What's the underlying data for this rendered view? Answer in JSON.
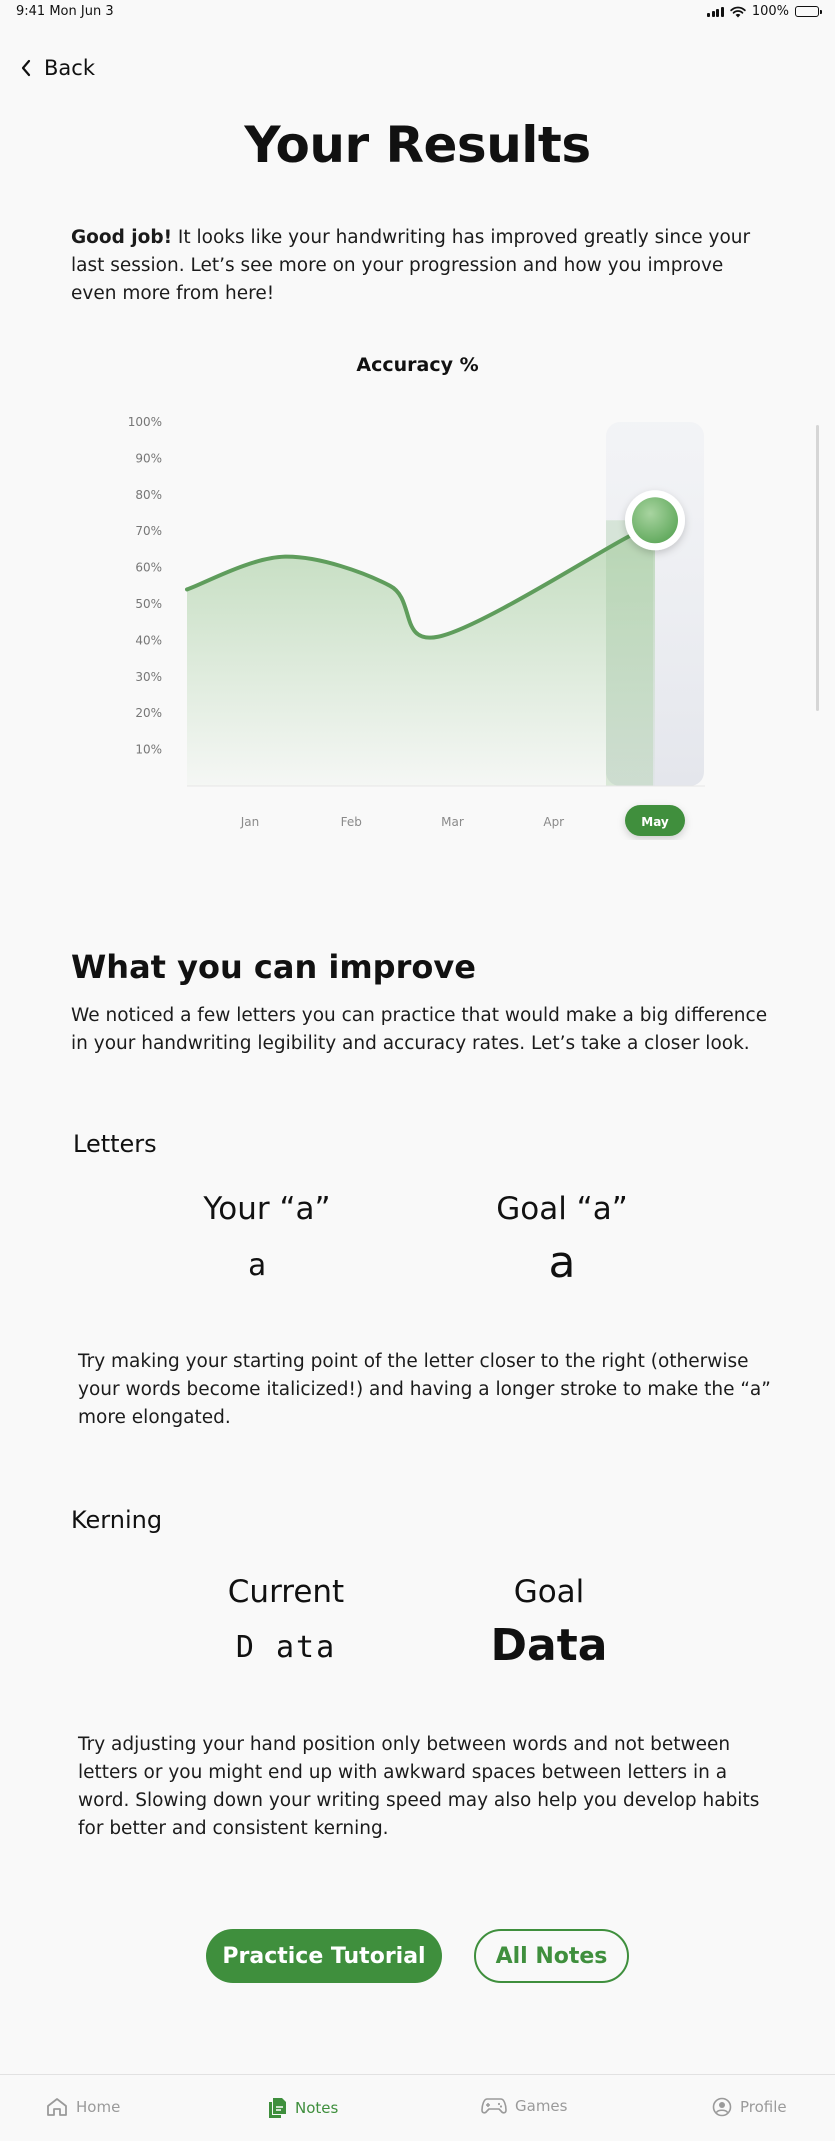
{
  "status_bar": {
    "time": "9:41",
    "date": "Mon Jun 3",
    "battery": "100%"
  },
  "nav": {
    "back_label": "Back"
  },
  "page": {
    "title": "Your Results",
    "intro_bold": "Good job!",
    "intro_text": " It looks like your handwriting has improved greatly since your last session. Let’s see more on your progression and how you improve even more from here!"
  },
  "chart_title": "Accuracy %",
  "chart_data": {
    "type": "area",
    "title": "Accuracy %",
    "categories": [
      "Jan",
      "Feb",
      "Mar",
      "Apr",
      "May"
    ],
    "values": [
      63,
      55,
      41,
      68,
      73
    ],
    "start_value": 54,
    "ylim": [
      0,
      100
    ],
    "yticks": [
      "10%",
      "20%",
      "30%",
      "40%",
      "50%",
      "60%",
      "70%",
      "80%",
      "90%",
      "100%"
    ],
    "selected": "May",
    "legend": "none",
    "grid": false,
    "colors": {
      "line": "#5f9d5c",
      "fill": "#a9cfa3",
      "selected_pill": "#3f8f3d"
    }
  },
  "improve": {
    "title": "What you can improve",
    "text": "We noticed a few letters you can practice that would make a big difference in your handwriting legibility and accuracy rates. Let’s take a closer look."
  },
  "letters": {
    "title": "Letters",
    "yours_heading": "Your “a”",
    "goal_heading": "Goal “a”",
    "yours_sample": "a",
    "goal_sample": "a",
    "tip": "Try making your starting point of the letter closer to the right (otherwise your words become italicized!) and having a longer stroke to make the “a” more elongated."
  },
  "kerning": {
    "title": "Kerning",
    "current_heading": "Current",
    "goal_heading": "Goal",
    "current_sample": "D ata",
    "goal_sample": "Data",
    "tip": "Try adjusting your hand position only between words and not between letters or you might end up with awkward spaces between letters in a word. Slowing down your writing speed may also help you develop habits for better and consistent kerning."
  },
  "actions": {
    "primary": "Practice Tutorial",
    "secondary": "All Notes"
  },
  "tabs": [
    {
      "label": "Home",
      "icon": "home-icon"
    },
    {
      "label": "Notes",
      "icon": "notes-icon",
      "active": true
    },
    {
      "label": "Games",
      "icon": "gamepad-icon"
    },
    {
      "label": "Profile",
      "icon": "profile-icon"
    }
  ],
  "accent_color": "#3f8f3d"
}
